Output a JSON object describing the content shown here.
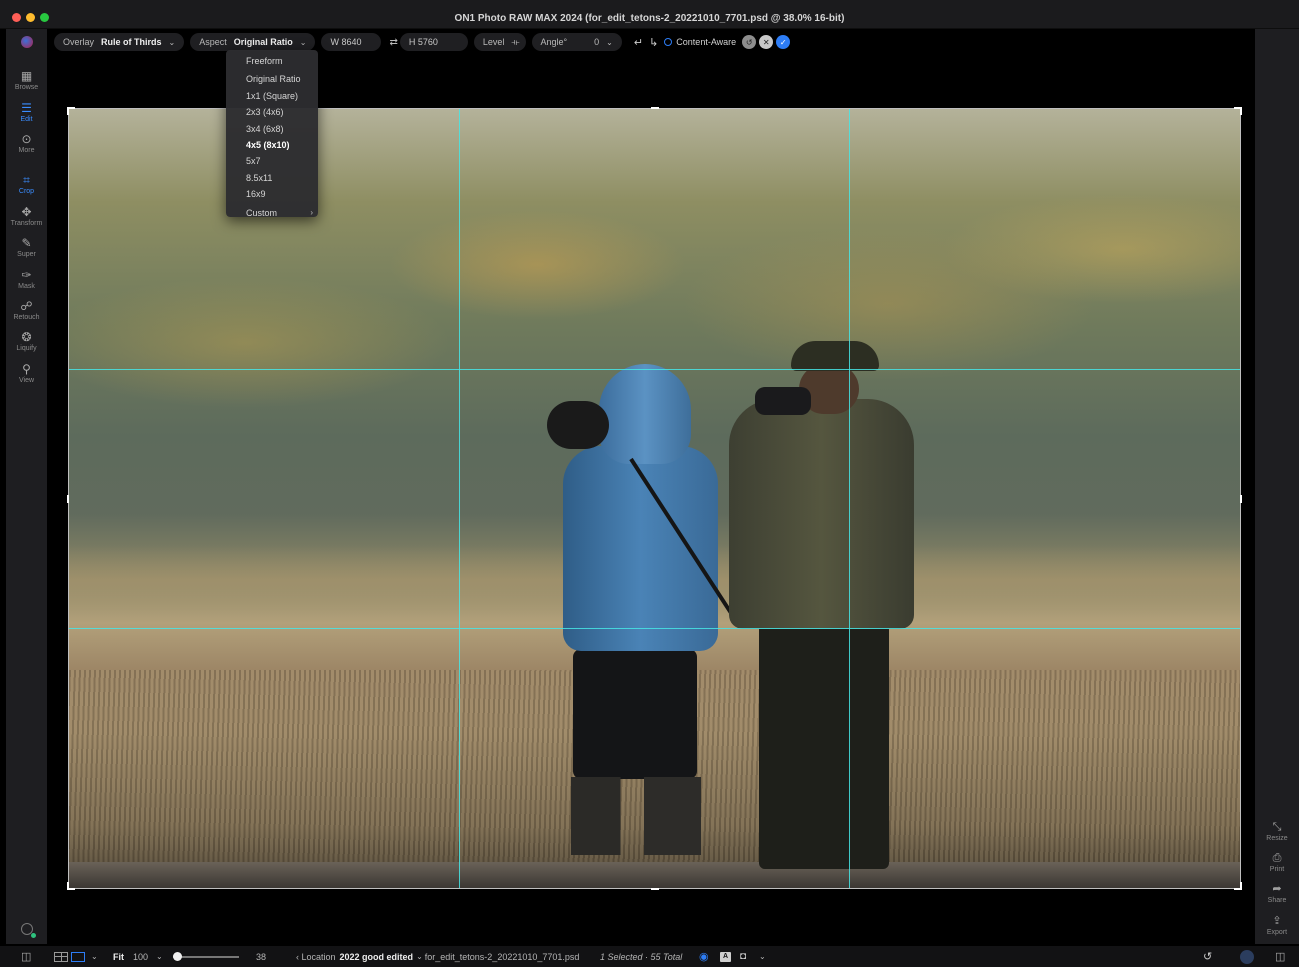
{
  "window": {
    "title": "ON1 Photo RAW MAX 2024 (for_edit_tetons-2_20221010_7701.psd @ 38.0% 16-bit)"
  },
  "left_tools": [
    {
      "label": "Browse",
      "icon": "grid-icon"
    },
    {
      "label": "Edit",
      "icon": "sliders-icon",
      "active": true
    },
    {
      "label": "More",
      "icon": "more-icon"
    },
    {
      "label": "Crop",
      "icon": "crop-icon",
      "active": true
    },
    {
      "label": "Transform",
      "icon": "move-icon"
    },
    {
      "label": "Super",
      "icon": "brush-icon"
    },
    {
      "label": "Mask",
      "icon": "mask-icon"
    },
    {
      "label": "Retouch",
      "icon": "retouch-icon"
    },
    {
      "label": "Liquify",
      "icon": "liquify-icon"
    },
    {
      "label": "View",
      "icon": "zoom-icon"
    }
  ],
  "right_tools": [
    {
      "label": "Resize",
      "icon": "resize-icon"
    },
    {
      "label": "Print",
      "icon": "print-icon"
    },
    {
      "label": "Share",
      "icon": "share-icon"
    },
    {
      "label": "Export",
      "icon": "export-icon"
    }
  ],
  "options": {
    "overlay_label": "Overlay",
    "overlay_value": "Rule of Thirds",
    "aspect_label": "Aspect",
    "aspect_value": "Original Ratio",
    "width": "W 8640",
    "height": "H 5760",
    "level_label": "Level",
    "angle_label": "Angle°",
    "angle_value": "0",
    "content_aware": "Content-Aware"
  },
  "aspect_menu": {
    "items": [
      "Freeform",
      "Original Ratio",
      "1x1 (Square)",
      "2x3 (4x6)",
      "3x4 (6x8)",
      "4x5 (8x10)",
      "5x7",
      "8.5x11",
      "16x9",
      "Custom"
    ],
    "selected": "4x5 (8x10)"
  },
  "bottom": {
    "fit": "Fit",
    "zoom": "100",
    "slider_value": "38",
    "location_prefix": "‹ Location",
    "folder": "2022 good edited",
    "file": "for_edit_tetons-2_20221010_7701.psd",
    "selection": "1 Selected · 55 Total"
  },
  "colors": {
    "accent": "#2d7df6",
    "grid": "#46e6e6"
  }
}
